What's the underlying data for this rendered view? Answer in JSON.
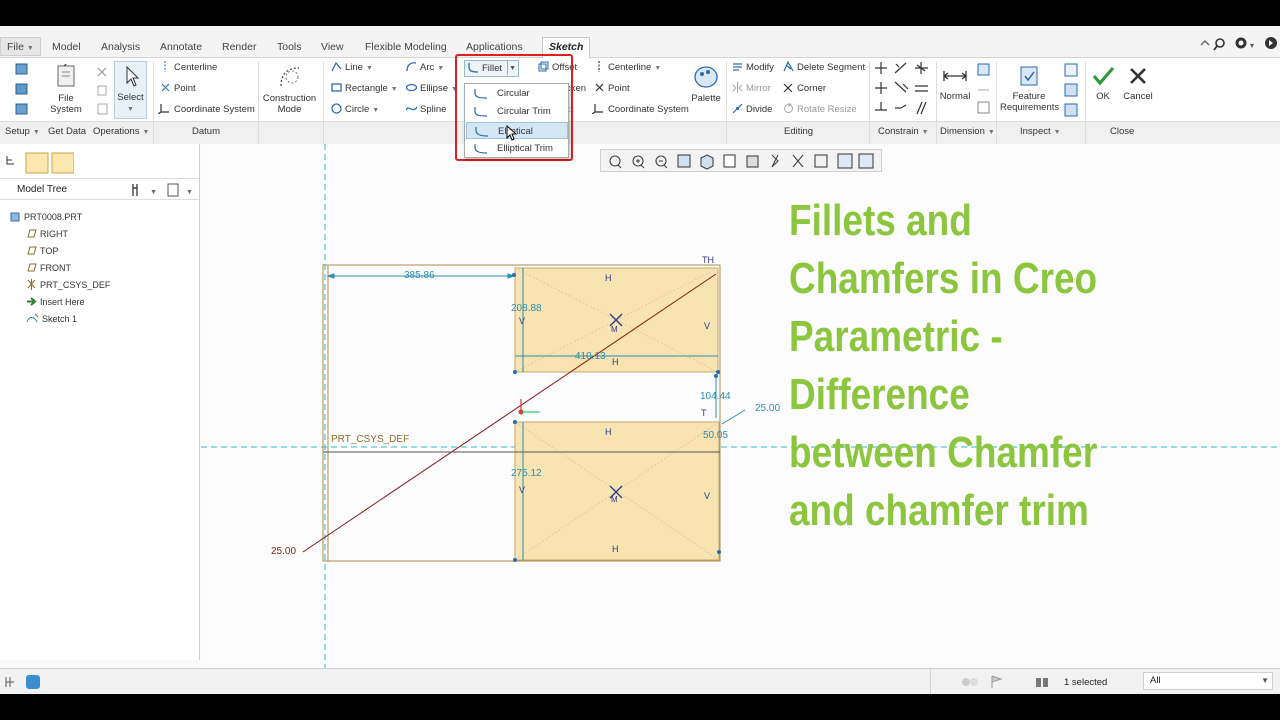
{
  "menubar": {
    "file_label": "File",
    "tabs": [
      "Model",
      "Analysis",
      "Annotate",
      "Render",
      "Tools",
      "View",
      "Flexible Modeling",
      "Applications"
    ],
    "active_tab": "Sketch"
  },
  "ribbon": {
    "setup": {
      "file_system": "File\nSystem",
      "select": "Select"
    },
    "datum": {
      "centerline": "Centerline",
      "point": "Point",
      "coordinate_system": "Coordinate System"
    },
    "construction_mode": "Construction\nMode",
    "sketching": {
      "line": "Line",
      "rectangle": "Rectangle",
      "circle": "Circle",
      "arc": "Arc",
      "ellipse": "Ellipse",
      "spline": "Spline",
      "fillet": "Fillet",
      "offset": "Offset",
      "thicken_partial": "cken",
      "project_partial": "ct",
      "centerline": "Centerline",
      "point": "Point",
      "coordinate_system": "Coordinate System",
      "palette": "Palette"
    },
    "editing": {
      "modify": "Modify",
      "delete_segment": "Delete Segment",
      "mirror": "Mirror",
      "corner": "Corner",
      "divide": "Divide",
      "rotate_resize": "Rotate Resize"
    },
    "normal": "Normal",
    "feature_requirements": "Feature\nRequirements",
    "ok": "OK",
    "cancel": "Cancel",
    "groups": {
      "setup": "Setup",
      "get_data": "Get Data",
      "operations": "Operations",
      "datum": "Datum",
      "editing": "Editing",
      "constrain": "Constrain",
      "dimension": "Dimension",
      "inspect": "Inspect",
      "close": "Close"
    }
  },
  "fillet_menu": {
    "items": [
      "Circular",
      "Circular Trim",
      "Elliptical",
      "Elliptical Trim"
    ],
    "highlighted": "Elliptical"
  },
  "model_tree": {
    "title": "Model Tree",
    "items": [
      "PRT0008.PRT",
      "RIGHT",
      "TOP",
      "FRONT",
      "PRT_CSYS_DEF",
      "Insert Here",
      "Sketch 1"
    ]
  },
  "sketch": {
    "dim_top_horizontal": "385.86",
    "dim_upper_height": "208.88",
    "dim_upper_width": "410.13",
    "dim_gap": "104.44",
    "dim_chamfer_a": "25.00",
    "dim_chamfer_b": "50.05",
    "dim_lower_height": "275.12",
    "dim_chamfer_c": "25.00",
    "csys_label": "PRT_CSYS_DEF",
    "constraint_h": "H",
    "constraint_v": "V",
    "constraint_t": "T",
    "constraint_th": "TH",
    "constraint_m": "M"
  },
  "overlay_title": [
    "Fillets and",
    "Chamfers in Creo",
    "Parametric -",
    "Difference",
    "between Chamfer",
    "and chamfer trim"
  ],
  "status": {
    "selected": "1 selected",
    "filter": "All"
  },
  "colors": {
    "accent_green": "#8cc63f",
    "dim_blue": "#2a8fb0",
    "sketch_fill": "#f8e3b3",
    "highlight_red": "#e02020"
  }
}
